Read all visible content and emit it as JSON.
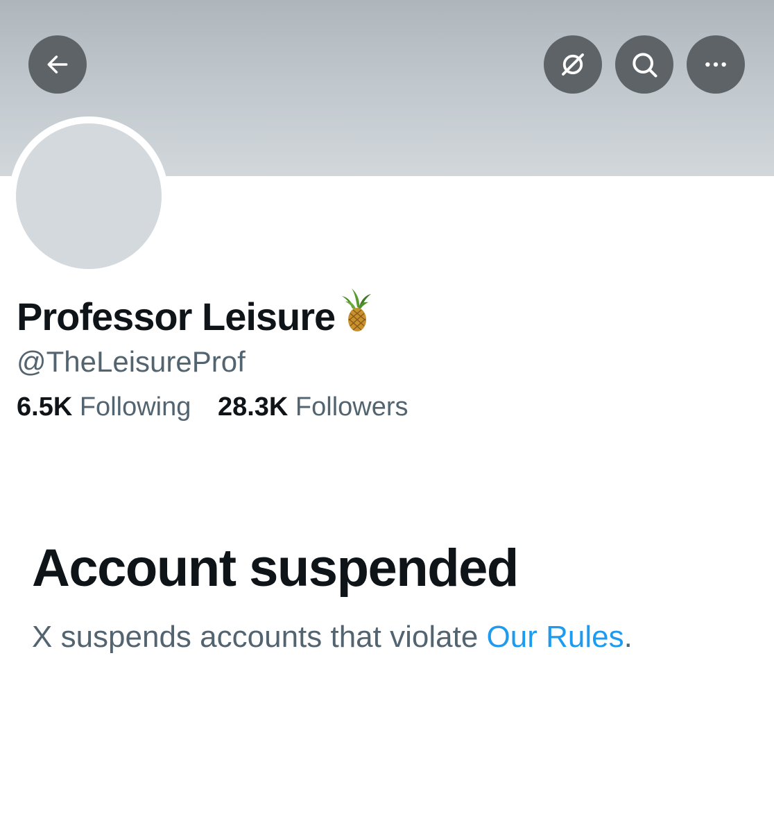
{
  "header": {
    "back_icon": "arrow-left-icon",
    "grok_icon": "grok-slash-circle-icon",
    "search_icon": "search-icon",
    "more_icon": "ellipsis-icon",
    "banner_color": "#c0c7cc",
    "button_color": "#5d6367"
  },
  "profile": {
    "display_name": "Professor Leisure",
    "name_emoji": "pineapple-emoji",
    "handle": "@TheLeisureProf",
    "avatar_color": "#d3d9dd",
    "stats": {
      "following_count": "6.5K",
      "following_label": "Following",
      "followers_count": "28.3K",
      "followers_label": "Followers"
    }
  },
  "suspension": {
    "title": "Account suspended",
    "message_prefix": "X suspends accounts that violate ",
    "link_text": "Our Rules",
    "message_suffix": ".",
    "link_color": "#1d9bf0",
    "text_color": "#536471"
  }
}
